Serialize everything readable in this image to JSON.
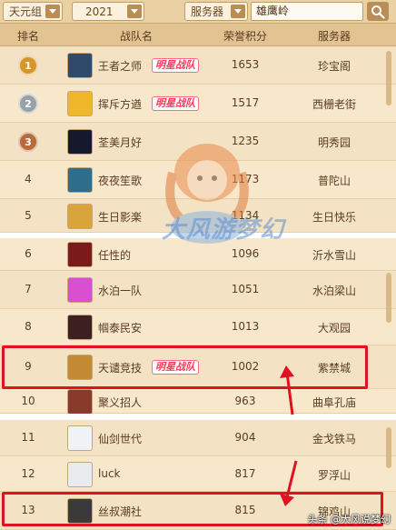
{
  "filters": {
    "group": "天元组",
    "year": "2021",
    "field": "服务器",
    "search_value": "雄鹰岭"
  },
  "columns": {
    "rank": "排名",
    "team": "战队名",
    "points": "荣誉积分",
    "server": "服务器"
  },
  "badge_label": "明星战队",
  "rows": [
    {
      "rank": "1",
      "team": "王者之师",
      "points": "1653",
      "server": "珍宝阁",
      "star": true
    },
    {
      "rank": "2",
      "team": "挥斥方遒",
      "points": "1517",
      "server": "西栅老街",
      "star": true
    },
    {
      "rank": "3",
      "team": "荃美月好",
      "points": "1235",
      "server": "明秀园",
      "star": false
    },
    {
      "rank": "4",
      "team": "夜夜笙歌",
      "points": "1173",
      "server": "普陀山",
      "star": false
    },
    {
      "rank": "5",
      "team": "生日影楽",
      "points": "1134",
      "server": "生日快乐",
      "star": false
    },
    {
      "rank": "6",
      "team": "任性的",
      "points": "1096",
      "server": "沂水雪山",
      "star": false
    },
    {
      "rank": "7",
      "team": "水泊一队",
      "points": "1051",
      "server": "水泊梁山",
      "star": false
    },
    {
      "rank": "8",
      "team": "帼泰民安",
      "points": "1013",
      "server": "大观园",
      "star": false
    },
    {
      "rank": "9",
      "team": "天谴竞技",
      "points": "1002",
      "server": "紫禁城",
      "star": true
    },
    {
      "rank": "10",
      "team": "聚义招人",
      "points": "963",
      "server": "曲阜孔庙",
      "star": false
    },
    {
      "rank": "11",
      "team": "仙剑世代",
      "points": "904",
      "server": "金戈铁马",
      "star": false
    },
    {
      "rank": "12",
      "team": "luck",
      "points": "817",
      "server": "罗浮山",
      "star": false
    },
    {
      "rank": "13",
      "team": "丝叔潮社",
      "points": "815",
      "server": "锦鸡山",
      "star": false
    }
  ],
  "watermark_text": "大风游梦幻",
  "footer_watermark": "头条 @大风说梦幻",
  "colors": {
    "highlight_red": "#e0121f",
    "badge_pink": "#ff3a5a",
    "medal_gold": "#d7962b",
    "medal_silver": "#9aa1a6",
    "medal_bronze": "#b86a3b"
  }
}
